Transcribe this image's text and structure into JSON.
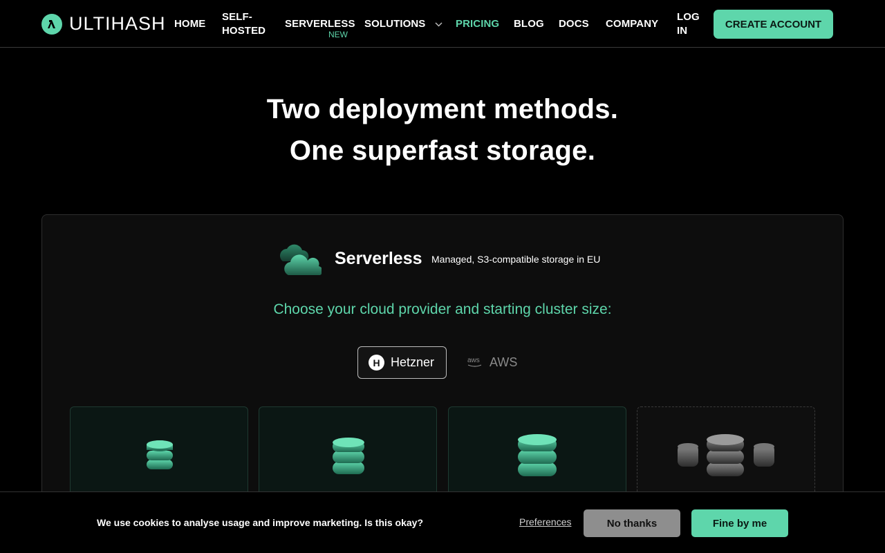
{
  "brand": {
    "name": "ULTIHASH",
    "accent": "#5ed6ab"
  },
  "nav": {
    "home": "HOME",
    "self_hosted_line1": "SELF-",
    "self_hosted_line2": "HOSTED",
    "serverless": "SERVERLESS",
    "serverless_badge": "NEW",
    "solutions": "SOLUTIONS",
    "pricing": "PRICING",
    "blog": "BLOG",
    "docs": "DOCS",
    "company": "COMPANY",
    "login_line1": "LOG",
    "login_line2": "IN",
    "create_account": "CREATE ACCOUNT",
    "active_item": "PRICING"
  },
  "hero": {
    "line1": "Two deployment methods.",
    "line2": "One superfast storage."
  },
  "serverless": {
    "title": "Serverless",
    "subtitle": "Managed, S3-compatible storage in EU",
    "choose_prompt": "Choose your cloud provider and starting cluster size:",
    "providers": [
      {
        "label": "Hetzner",
        "icon": "hetzner-h-icon",
        "selected": true
      },
      {
        "label": "AWS",
        "icon": "aws-icon",
        "icon_text": "aws",
        "selected": false
      }
    ],
    "cluster_cards": [
      {
        "icon": "database-small-icon"
      },
      {
        "icon": "database-medium-icon"
      },
      {
        "icon": "database-large-icon"
      },
      {
        "icon": "database-cluster-custom-icon"
      }
    ]
  },
  "cookie": {
    "message": "We use cookies to analyse usage and improve marketing. Is this okay?",
    "preferences": "Preferences",
    "decline": "No thanks",
    "accept": "Fine by me"
  }
}
